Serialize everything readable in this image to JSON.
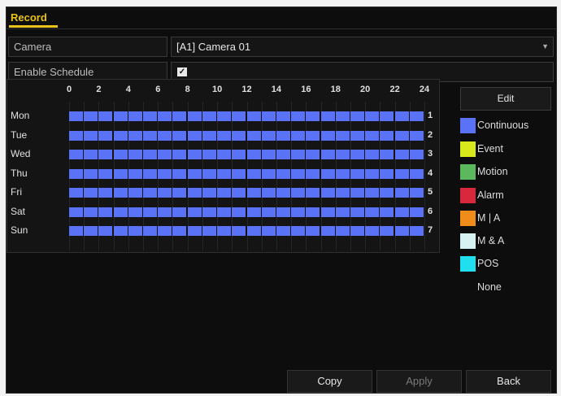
{
  "tab": {
    "title": "Record"
  },
  "form": {
    "camera_label": "Camera",
    "camera_value": "[A1] Camera 01",
    "schedule_label": "Enable Schedule",
    "schedule_checked": true
  },
  "schedule": {
    "hours": [
      "0",
      "2",
      "4",
      "6",
      "8",
      "10",
      "12",
      "14",
      "16",
      "18",
      "20",
      "22",
      "24"
    ],
    "days": [
      {
        "label": "Mon",
        "num": "1"
      },
      {
        "label": "Tue",
        "num": "2"
      },
      {
        "label": "Wed",
        "num": "3"
      },
      {
        "label": "Thu",
        "num": "4"
      },
      {
        "label": "Fri",
        "num": "5"
      },
      {
        "label": "Sat",
        "num": "6"
      },
      {
        "label": "Sun",
        "num": "7"
      }
    ],
    "recording_type": "Continuous",
    "recording_color": "#5a72f5",
    "coverage": "00:00-24:00"
  },
  "legend": {
    "edit_label": "Edit",
    "items": [
      {
        "label": "Continuous",
        "color": "#5a72f5"
      },
      {
        "label": "Event",
        "color": "#d8e81a"
      },
      {
        "label": "Motion",
        "color": "#5cb85c"
      },
      {
        "label": "Alarm",
        "color": "#d9283c"
      },
      {
        "label": "M | A",
        "color": "#f08c1a"
      },
      {
        "label": "M & A",
        "color": "#d6f2f2"
      },
      {
        "label": "POS",
        "color": "#20e0f0"
      },
      {
        "label": "None",
        "color": "#0d0d0d"
      }
    ]
  },
  "buttons": {
    "copy": "Copy",
    "apply": "Apply",
    "back": "Back"
  }
}
